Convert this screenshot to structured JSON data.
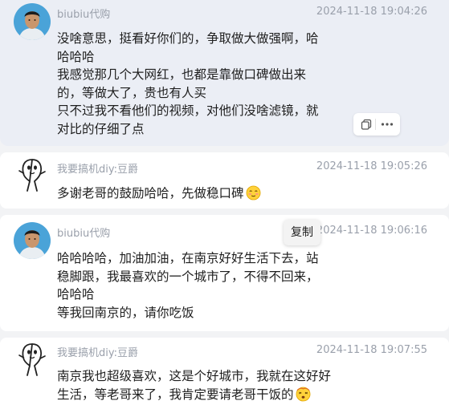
{
  "messages": [
    {
      "sender": "biubiu代购",
      "time": "2024-11-18 19:04:26",
      "lines": [
        "没啥意思，挺看好你们的，争取做大做强啊，哈",
        "哈哈哈",
        "我感觉那几个大网红，也都是靠做口碑做出来",
        "的，等做大了，贵也有人买",
        "只不过我不看他们的视频，对他们没啥滤镜，就",
        "对比的仔细了点"
      ],
      "actions": [
        "copy-icon",
        "more-icon"
      ]
    },
    {
      "sender": "我要搞机diy:豆爵",
      "time": "2024-11-18 19:05:26",
      "lines": [
        "多谢老哥的鼓励哈哈，先做稳口碑"
      ],
      "emoji": "shy-smile-emoji"
    },
    {
      "sender": "biubiu代购",
      "time": "2024-11-18 19:06:16",
      "lines": [
        "哈哈哈哈，加油加油，在南京好好生活下去，站",
        "稳脚跟，我最喜欢的一个城市了，不得不回来，",
        "哈哈哈",
        "等我回南京的，请你吃饭"
      ]
    },
    {
      "sender": "我要搞机diy:豆爵",
      "time": "2024-11-18 19:07:55",
      "lines": [
        "南京我也超级喜欢，这是个好城市，我就在这好好",
        "生活，等老哥来了，我肯定要请老哥干饭的"
      ],
      "emoji": "dizzy-face-emoji"
    }
  ],
  "tooltip": {
    "label": "复制"
  },
  "colors": {
    "selected_bg": "#ebeef5",
    "card_bg": "#ffffff",
    "page_bg": "#f2f3f5",
    "meta_text": "#9aa0ab"
  }
}
